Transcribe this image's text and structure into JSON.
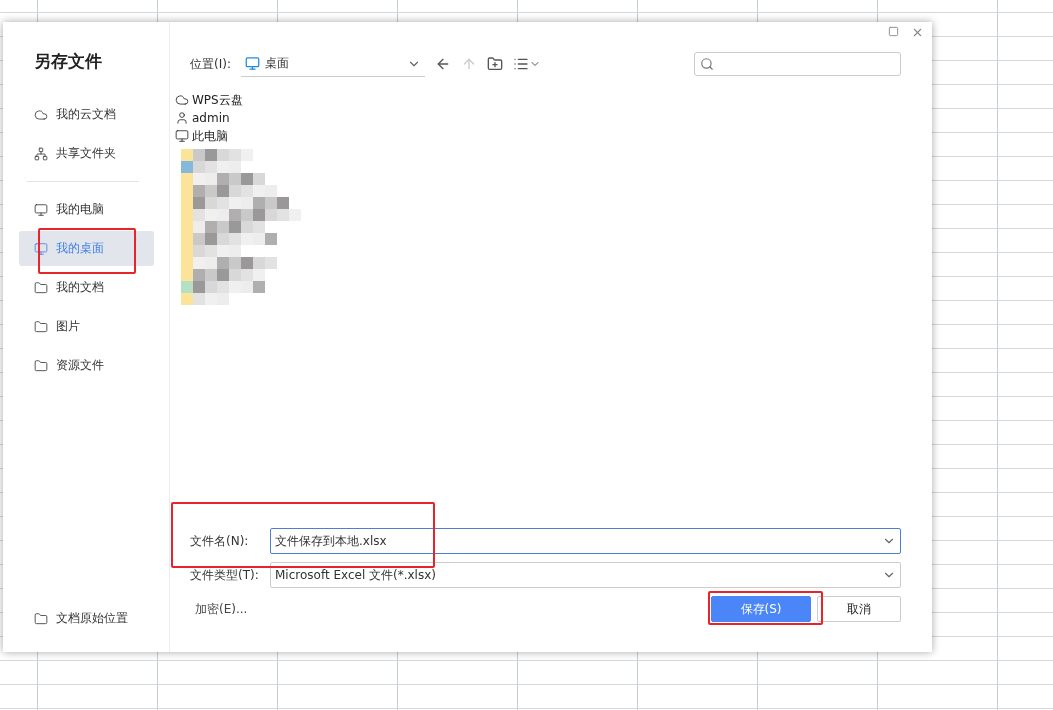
{
  "dialog": {
    "title": "另存文件",
    "sidebar": {
      "groups": [
        [
          {
            "label": "我的云文档",
            "selected": false
          },
          {
            "label": "共享文件夹",
            "selected": false
          }
        ],
        [
          {
            "label": "我的电脑",
            "selected": false
          },
          {
            "label": "我的桌面",
            "selected": true
          },
          {
            "label": "我的文档",
            "selected": false
          },
          {
            "label": "图片",
            "selected": false
          },
          {
            "label": "资源文件",
            "selected": false
          }
        ]
      ],
      "bottom_item": {
        "label": "文档原始位置"
      }
    },
    "location": {
      "label": "位置(I):",
      "value": "桌面"
    },
    "files": [
      {
        "name": "WPS云盘"
      },
      {
        "name": "admin"
      },
      {
        "name": "此电脑"
      }
    ],
    "filename": {
      "label": "文件名(N):",
      "value": "文件保存到本地.xlsx"
    },
    "filetype": {
      "label": "文件类型(T):",
      "value": "Microsoft Excel 文件(*.xlsx)"
    },
    "encrypt": "加密(E)...",
    "buttons": [
      {
        "label": "保存(S)",
        "kind": "primary"
      },
      {
        "label": "取消",
        "kind": "secondary"
      }
    ]
  }
}
